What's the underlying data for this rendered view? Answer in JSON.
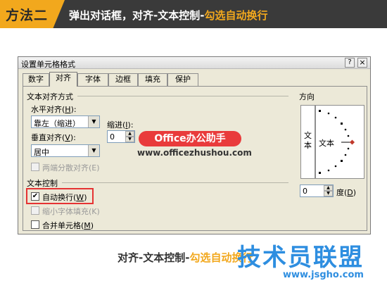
{
  "banner": {
    "badge": "方法二",
    "text_prefix": "弹出对话框，对齐-文本控制-",
    "text_highlight": "勾选自动换行"
  },
  "dialog": {
    "title": "设置单元格格式",
    "help_icon": "?",
    "close_icon": "×",
    "tabs": [
      "数字",
      "对齐",
      "字体",
      "边框",
      "填充",
      "保护"
    ],
    "active_tab": "对齐",
    "text_alignment": {
      "group_label": "文本对齐方式",
      "horizontal_label": "水平对齐(",
      "horizontal_key": "H",
      "horizontal_value": "靠左（缩进）",
      "vertical_label": "垂直对齐(",
      "vertical_key": "V",
      "vertical_value": "居中",
      "indent_label": "缩进(",
      "indent_key": "I",
      "indent_value": "0",
      "distributed_label": "两端分散对齐(E)"
    },
    "text_control": {
      "group_label": "文本控制",
      "wrap_label": "自动换行(",
      "wrap_key": "W",
      "wrap_checked": "✔",
      "shrink_label": "缩小字体填充(K)",
      "merge_label": "合并单元格(",
      "merge_key": "M"
    },
    "orientation": {
      "group_label": "方向",
      "vertical_text": "文本",
      "dial_text": "文本",
      "degree_value": "0",
      "degree_label": "度(",
      "degree_key": "D"
    }
  },
  "overlay": {
    "badge": "Office办公助手",
    "url": "www.officezhushou.com"
  },
  "caption": {
    "prefix": "对齐-文本控制-",
    "highlight": "勾选自动换行"
  },
  "site": {
    "logo": "技术员联盟",
    "url": "www.jsgho.com"
  },
  "colors": {
    "accent": "#f2a81d",
    "highlight_border": "#e53333",
    "badge_red": "#e93b3b",
    "logo_blue": "#2e8ee0"
  }
}
